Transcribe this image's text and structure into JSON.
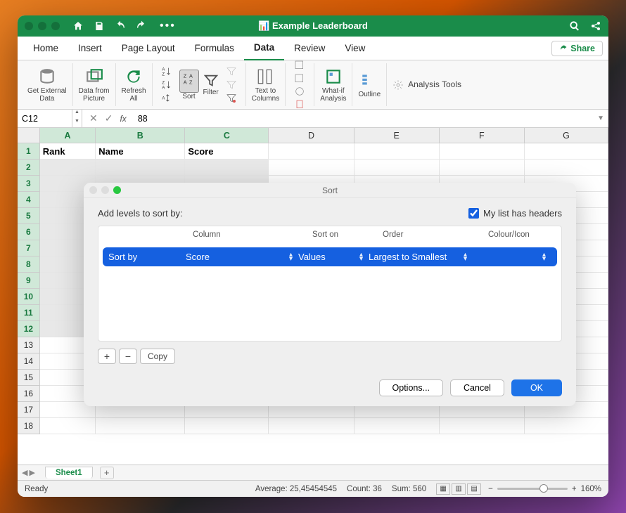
{
  "titlebar": {
    "title": "Example Leaderboard"
  },
  "menu": {
    "items": [
      "Home",
      "Insert",
      "Page Layout",
      "Formulas",
      "Data",
      "Review",
      "View"
    ],
    "active": "Data",
    "share": "Share"
  },
  "ribbon": {
    "ext_data": "Get External\nData",
    "pic_data": "Data from\nPicture",
    "refresh": "Refresh\nAll",
    "sort": "Sort",
    "filter": "Filter",
    "text_cols": "Text to\nColumns",
    "whatif": "What-if\nAnalysis",
    "outline": "Outline",
    "tools": "Analysis Tools"
  },
  "formula_bar": {
    "name_box": "C12",
    "value": "88"
  },
  "columns": [
    "A",
    "B",
    "C",
    "D",
    "E",
    "F",
    "G"
  ],
  "rows_visible": 18,
  "selection": {
    "active": "C12",
    "first_row": 1,
    "last_row": 12,
    "first_col": "A",
    "last_col": "C"
  },
  "data_cells": {
    "A1": "Rank",
    "B1": "Name",
    "C1": "Score"
  },
  "dialog": {
    "title": "Sort",
    "prompt": "Add levels to sort by:",
    "headers_label": "My list has headers",
    "headers_checked": true,
    "cols": [
      "",
      "Column",
      "Sort on",
      "Order",
      "Colour/Icon"
    ],
    "level": {
      "label": "Sort by",
      "column": "Score",
      "sort_on": "Values",
      "order": "Largest to Smallest"
    },
    "copy": "Copy",
    "options": "Options...",
    "cancel": "Cancel",
    "ok": "OK"
  },
  "sheets": {
    "active": "Sheet1"
  },
  "status": {
    "ready": "Ready",
    "average": "Average: 25,45454545",
    "count": "Count: 36",
    "sum": "Sum: 560",
    "zoom": "160%"
  }
}
